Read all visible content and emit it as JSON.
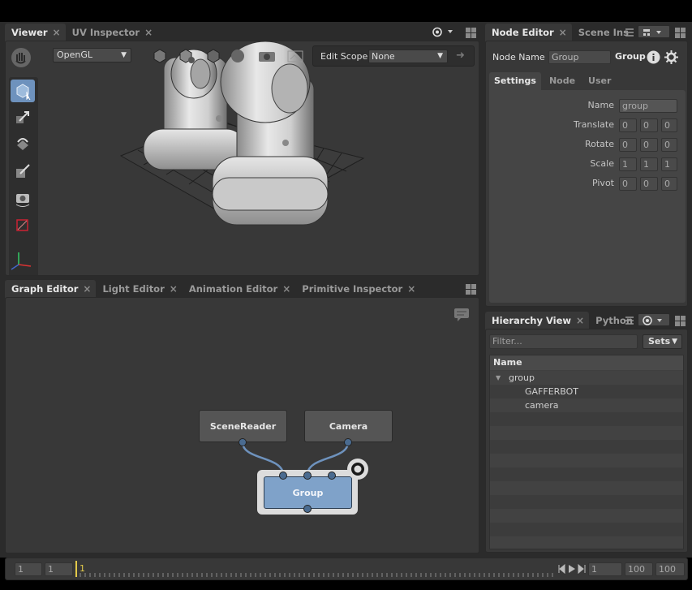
{
  "viewer": {
    "tabs": [
      {
        "label": "Viewer"
      },
      {
        "label": "UV Inspector"
      }
    ],
    "renderer": "OpenGL",
    "edit_scope_label": "Edit Scope",
    "edit_scope_value": "None"
  },
  "node_editor": {
    "tabs": [
      {
        "label": "Node Editor"
      },
      {
        "label": "Scene Inspe"
      }
    ],
    "node_name_label": "Node Name",
    "node_name_value": "Group",
    "node_type": "Group",
    "subtabs": [
      {
        "label": "Settings"
      },
      {
        "label": "Node"
      },
      {
        "label": "User"
      }
    ],
    "name_label": "Name",
    "name_value": "group",
    "translate_label": "Translate",
    "translate": [
      "0",
      "0",
      "0"
    ],
    "rotate_label": "Rotate",
    "rotate": [
      "0",
      "0",
      "0"
    ],
    "scale_label": "Scale",
    "scale": [
      "1",
      "1",
      "1"
    ],
    "pivot_label": "Pivot",
    "pivot": [
      "0",
      "0",
      "0"
    ]
  },
  "graph_editor": {
    "tabs": [
      {
        "label": "Graph Editor"
      },
      {
        "label": "Light Editor"
      },
      {
        "label": "Animation Editor"
      },
      {
        "label": "Primitive Inspector"
      }
    ],
    "nodes": {
      "scene_reader": "SceneReader",
      "camera": "Camera",
      "group": "Group"
    }
  },
  "hierarchy": {
    "tabs": [
      {
        "label": "Hierarchy View"
      },
      {
        "label": "Python"
      }
    ],
    "filter_placeholder": "Filter...",
    "sets_label": "Sets",
    "column_name": "Name",
    "rows": [
      {
        "label": "group"
      },
      {
        "label": "GAFFERBOT"
      },
      {
        "label": "camera"
      }
    ]
  },
  "timeline": {
    "start_a": "1",
    "start_b": "1",
    "current_frame": "1",
    "current": "1",
    "end_a": "100",
    "end_b": "100"
  },
  "colors": {
    "accent": "#6e92bd",
    "node_selected": "#7fa2c9",
    "playhead": "#e2c94a"
  }
}
